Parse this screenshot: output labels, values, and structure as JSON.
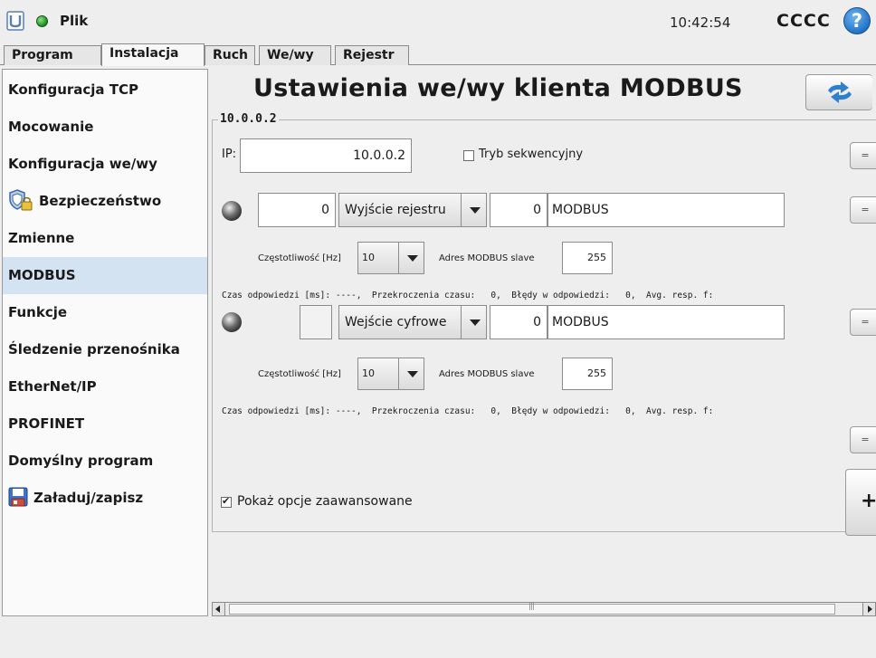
{
  "header": {
    "app_menu": "Plik",
    "clock": "10:42:54",
    "robot_name": "CCCC",
    "help_icon_label": "?"
  },
  "tabs": [
    {
      "label": "Program",
      "active": false
    },
    {
      "label": "Instalacja",
      "active": true
    },
    {
      "label": "Ruch",
      "active": false
    },
    {
      "label": "We/wy",
      "active": false
    },
    {
      "label": "Rejestr",
      "active": false
    }
  ],
  "sidebar": {
    "items": [
      {
        "label": "Konfiguracja TCP",
        "active": false
      },
      {
        "label": "Mocowanie",
        "active": false
      },
      {
        "label": "Konfiguracja we/wy",
        "active": false
      },
      {
        "label": "Bezpieczeństwo",
        "active": false,
        "icon": "shield-lock-icon"
      },
      {
        "label": "Zmienne",
        "active": false
      },
      {
        "label": "MODBUS",
        "active": true
      },
      {
        "label": "Funkcje",
        "active": false
      },
      {
        "label": "Śledzenie przenośnika",
        "active": false
      },
      {
        "label": "EtherNet/IP",
        "active": false
      },
      {
        "label": "PROFINET",
        "active": false
      },
      {
        "label": "Domyślny program",
        "active": false
      },
      {
        "label": "Załaduj/zapisz",
        "active": false,
        "icon": "floppy-disk-icon"
      }
    ]
  },
  "main": {
    "title": "Ustawienia we/wy klienta MODBUS",
    "refresh_icon": "refresh-arrows-icon",
    "unit": {
      "legend": "10.0.0.2",
      "ip_label": "IP:",
      "ip_value": "10.0.0.2",
      "sequential_label": "Tryb sekwencyjny",
      "sequential_checked": false
    },
    "signals": [
      {
        "address": "0",
        "type": "Wyjście rejestru",
        "value": "0",
        "name": "MODBUS",
        "frequency_label": "Częstotliwość [Hz]",
        "frequency": "10",
        "slave_label": "Adres MODBUS slave",
        "slave": "255",
        "stats": "Czas odpowiedzi [ms]: ----,  Przekroczenia czasu:   0,  Błędy w odpowiedzi:   0,  Avg. resp. f:"
      },
      {
        "address": "",
        "type": "Wejście cyfrowe",
        "value": "0",
        "name": "MODBUS",
        "frequency_label": "Częstotliwość [Hz]",
        "frequency": "10",
        "slave_label": "Adres MODBUS slave",
        "slave": "255",
        "stats": "Czas odpowiedzi [ms]: ----,  Przekroczenia czasu:   0,  Błędy w odpowiedzi:   0,  Avg. resp. f:"
      }
    ],
    "side_button_label": "=",
    "advanced_label": "Pokaż opcje zaawansowane",
    "advanced_checked": true,
    "add_button_label": "+"
  },
  "colors": {
    "active_sidebar": "#d4e3f1",
    "background": "#eeeeee"
  }
}
